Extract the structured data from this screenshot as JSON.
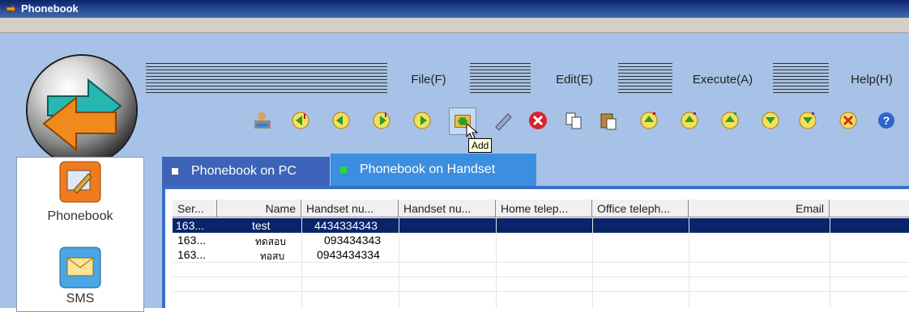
{
  "window": {
    "title": "Phonebook"
  },
  "menus": [
    {
      "label": "File(F)"
    },
    {
      "label": "Edit(E)"
    },
    {
      "label": "Execute(A)"
    },
    {
      "label": "Help(H)"
    }
  ],
  "toolbar": {
    "buttons": [
      {
        "icon": "phonebook-contact-icon"
      },
      {
        "icon": "download-all-icon"
      },
      {
        "icon": "download-icon"
      },
      {
        "icon": "upload-all-icon"
      },
      {
        "icon": "upload-icon"
      },
      {
        "icon": "add-icon"
      },
      {
        "icon": "edit-icon"
      },
      {
        "icon": "delete-icon"
      },
      {
        "icon": "copy-icon"
      },
      {
        "icon": "paste-icon"
      },
      {
        "icon": "sync-icon"
      },
      {
        "icon": "sync-p-icon"
      },
      {
        "icon": "sync-v-icon"
      },
      {
        "icon": "backup-icon"
      },
      {
        "icon": "restore-icon"
      },
      {
        "icon": "remove-icon"
      },
      {
        "icon": "help-icon"
      }
    ],
    "tooltip": "Add"
  },
  "sidebar": {
    "items": [
      {
        "label": "Phonebook"
      },
      {
        "label": "SMS"
      }
    ]
  },
  "tabs": [
    {
      "label": "Phonebook on PC",
      "active": false
    },
    {
      "label": "Phonebook on Handset",
      "active": true
    }
  ],
  "table": {
    "columns": [
      "Ser...",
      "Name",
      "Handset nu...",
      "Handset nu...",
      "Home telep...",
      "Office teleph...",
      "Email"
    ],
    "rows": [
      {
        "serial": "163...",
        "name": "test",
        "handset1": "4434334343",
        "selected": true
      },
      {
        "serial": "163...",
        "name": "ทดสอบ",
        "handset1": "093434343",
        "selected": false
      },
      {
        "serial": "163...",
        "name": "ทอสบ",
        "handset1": "0943434334",
        "selected": false
      }
    ]
  }
}
